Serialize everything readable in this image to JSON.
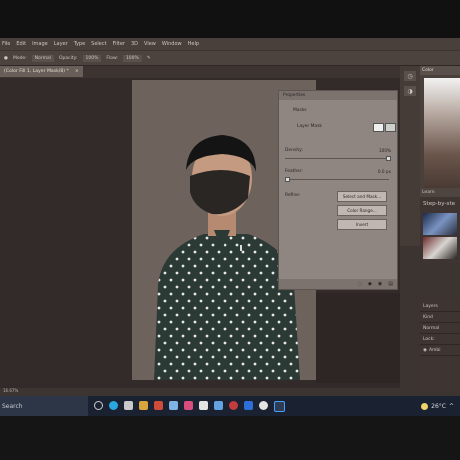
{
  "menubar": {
    "items": [
      "File",
      "Edit",
      "Image",
      "Layer",
      "Type",
      "Select",
      "Filter",
      "3D",
      "View",
      "Window",
      "Help"
    ]
  },
  "options": {
    "mode_label": "Mode:",
    "mode_value": "Normal",
    "opacity_label": "Opacity:",
    "opacity_value": "100%",
    "flow_label": "Flow:",
    "flow_value": "100%"
  },
  "document_tab": {
    "title": "(Color Fill 1, Layer Mask/8) *"
  },
  "properties": {
    "title": "Properties",
    "section_label": "Masks",
    "layer_mask_label": "Layer Mask",
    "density_label": "Density:",
    "density_value": "100%",
    "feather_label": "Feather:",
    "feather_value": "0.0 px",
    "refine_label": "Refine:",
    "btn_select_mask": "Select and Mask...",
    "btn_color_range": "Color Range...",
    "btn_invert": "Invert"
  },
  "color_panel": {
    "tab": "Color"
  },
  "learn_panel": {
    "tab": "Learn",
    "heading": "Step-by-ste"
  },
  "layers_panel": {
    "tab": "Layers",
    "filter_label": "Kind",
    "blend_label": "Normal",
    "lock_label": "Lock:",
    "layer_label": "Ambi"
  },
  "status": {
    "zoom": "16.67%"
  },
  "taskbar": {
    "search_placeholder": "Search",
    "temperature": "26°C",
    "icon_colors": [
      "#3b78d8",
      "#2aa7e1",
      "#c9c9c9",
      "#d9a43b",
      "#cf4b3a",
      "#7fb3e6",
      "#d94c7e",
      "#e3e3e3",
      "#63a4e0",
      "#c43c3c",
      "#2c6fd6",
      "#e3e3e3",
      "#3b6bd6"
    ]
  }
}
